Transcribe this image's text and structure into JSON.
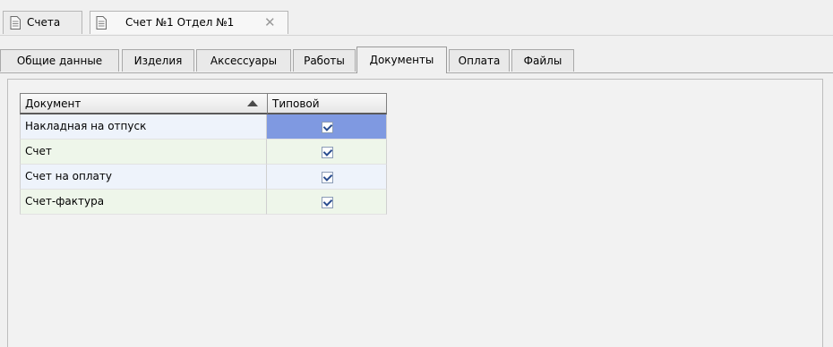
{
  "document_tabs": [
    {
      "label": "Счета",
      "active": false
    },
    {
      "label": "Счет №1 Отдел №1",
      "active": true,
      "closable": true,
      "close_glyph": "✕"
    }
  ],
  "section_tabs": [
    {
      "label": "Общие данные"
    },
    {
      "label": "Изделия"
    },
    {
      "label": "Аксессуары"
    },
    {
      "label": "Работы"
    },
    {
      "label": "Документы",
      "active": true
    },
    {
      "label": "Оплата"
    },
    {
      "label": "Файлы"
    }
  ],
  "grid": {
    "columns": [
      {
        "label": "Документ",
        "sort": "ascending"
      },
      {
        "label": "Типовой"
      }
    ],
    "rows": [
      {
        "document": "Накладная на отпуск",
        "typical": true,
        "selected": true
      },
      {
        "document": "Счет",
        "typical": true
      },
      {
        "document": "Счет на оплату",
        "typical": true
      },
      {
        "document": "Счет-фактура",
        "typical": true
      }
    ]
  },
  "colors": {
    "selection": "#7f99e1",
    "row_alt_a": "#eef3fb",
    "row_alt_b": "#eef6ea"
  },
  "icons": {
    "document_tab_icon": "document-icon",
    "sort_icon": "sort-ascending-icon",
    "close_icon": "close-icon"
  }
}
